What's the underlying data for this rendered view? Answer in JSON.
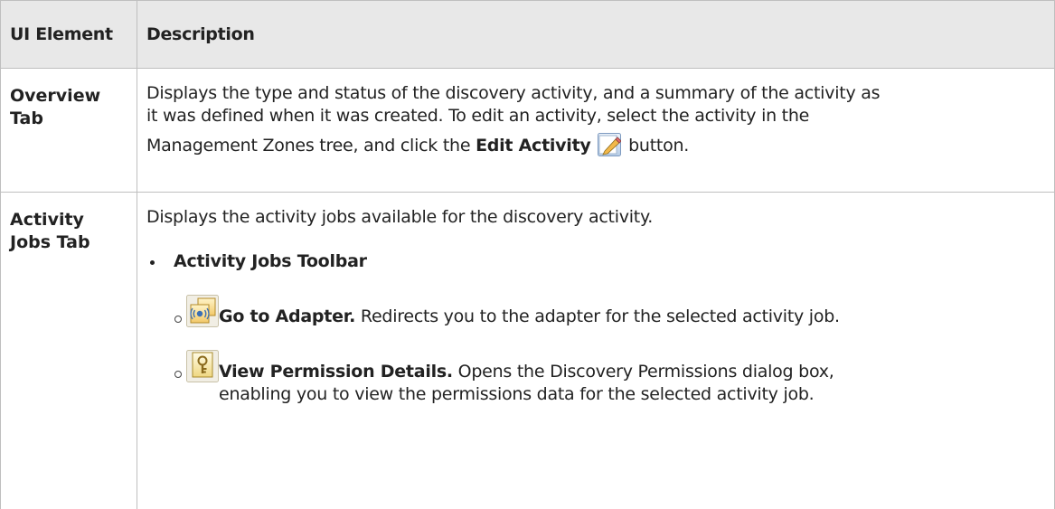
{
  "table": {
    "headers": [
      "UI Element",
      "Description"
    ],
    "rows": [
      {
        "element": [
          "Overview",
          "Tab"
        ],
        "desc_line1": "Displays the type and status of the discovery activity, and a summary of the activity as",
        "desc_line2": "it was defined when it was created. To edit an activity, select the activity in the",
        "desc_line3_prefix": "Management Zones tree, and click the ",
        "desc_line3_bold": "Edit Activity",
        "desc_line3_suffix": " button.",
        "icon": "pencil-edit-icon"
      },
      {
        "element": [
          "Activity",
          "Jobs Tab"
        ],
        "intro": "Displays the activity jobs available for the discovery activity.",
        "bullet": "Activity Jobs Toolbar",
        "items": [
          {
            "icon": "go-to-adapter-icon",
            "title": "Go to Adapter.",
            "text": " Redirects you to the adapter for the selected activity job."
          },
          {
            "icon": "view-permission-details-icon",
            "title": "View Permission Details.",
            "text_line1": " Opens the Discovery Permissions dialog box,",
            "text_line2": "enabling you to view the permissions data for the selected activity job."
          }
        ]
      }
    ]
  },
  "colors": {
    "header_bg": "#e8e8e8",
    "border": "#bfbfbf",
    "text": "#222222"
  }
}
